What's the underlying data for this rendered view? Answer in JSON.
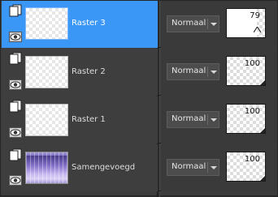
{
  "layers": [
    {
      "name": "Raster 3",
      "blend_mode": "Normaal",
      "opacity": "79",
      "selected": true,
      "thumb": "transparent"
    },
    {
      "name": "Raster 2",
      "blend_mode": "Normaal",
      "opacity": "100",
      "selected": false,
      "thumb": "transparent"
    },
    {
      "name": "Raster 1",
      "blend_mode": "Normaal",
      "opacity": "100",
      "selected": false,
      "thumb": "transparent"
    },
    {
      "name": "Samengevoegd",
      "blend_mode": "Normaal",
      "opacity": "100",
      "selected": false,
      "thumb": "image"
    }
  ],
  "icons": {
    "layer_group": "layer-group-icon",
    "visibility": "eye-icon",
    "dropdown": "chevron-down-icon"
  },
  "colors": {
    "selected_row": "#3a97f6",
    "panel_bg": "#3e3e3e"
  }
}
